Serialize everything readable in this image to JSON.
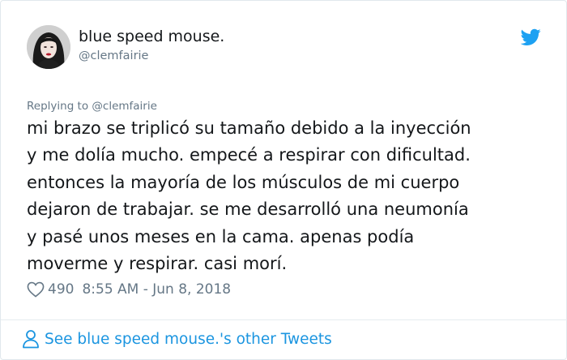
{
  "tweet": {
    "display_name": "blue speed mouse.",
    "handle": "@clemfairie",
    "replying_to": "Replying to @clemfairie",
    "lines": [
      "mi brazo se triplicó su tamaño debido a la inyección",
      "y me dolía mucho. empecé a respirar con dificultad.",
      "entonces la mayoría de los músculos de mi cuerpo",
      "dejaron de trabajar. se me desarrolló una neumonía",
      "y pasé unos meses en la cama. apenas podía",
      "moverme y respirar. casi morí."
    ],
    "likes": "490",
    "timestamp": "8:55 AM - Jun 8, 2018"
  },
  "footer": {
    "see_more_label": "See blue speed mouse.'s other Tweets"
  },
  "icons": {
    "brand": "twitter-bird-icon",
    "like": "heart-icon",
    "profile": "person-icon"
  },
  "colors": {
    "link_blue": "#1b95e0",
    "twitter_blue": "#1da1f2",
    "text": "#14171a",
    "muted": "#657786"
  }
}
